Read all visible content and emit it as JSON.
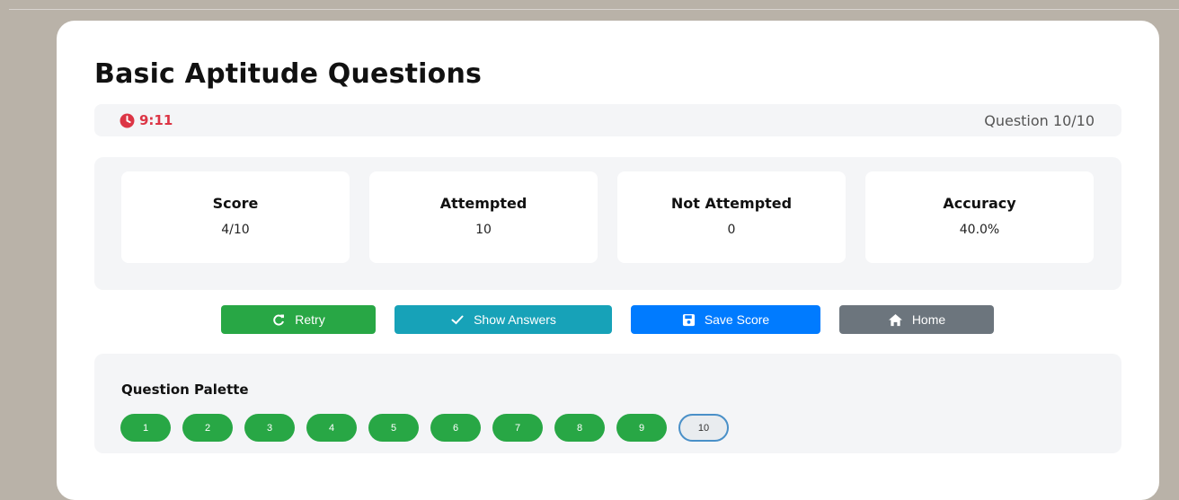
{
  "quiz": {
    "title": "Basic Aptitude Questions",
    "timer": "9:11",
    "question_counter": "Question 10/10"
  },
  "stats": [
    {
      "label": "Score",
      "value": "4/10"
    },
    {
      "label": "Attempted",
      "value": "10"
    },
    {
      "label": "Not Attempted",
      "value": "0"
    },
    {
      "label": "Accuracy",
      "value": "40.0%"
    }
  ],
  "actions": {
    "retry": "Retry",
    "show_answers": "Show Answers",
    "save_score": "Save Score",
    "home": "Home"
  },
  "palette": {
    "title": "Question Palette",
    "questions": [
      "1",
      "2",
      "3",
      "4",
      "5",
      "6",
      "7",
      "8",
      "9",
      "10"
    ],
    "current": "10"
  },
  "colors": {
    "timer": "#dc3545",
    "answered": "#28a745",
    "retry": "#28a745",
    "show_answers": "#17a2b8",
    "save_score": "#007bff",
    "home": "#6c757d"
  },
  "icons": {
    "timer": "clock-icon",
    "retry": "redo-icon",
    "show_answers": "check-icon",
    "save_score": "floppy-disk-icon",
    "home": "house-icon"
  }
}
